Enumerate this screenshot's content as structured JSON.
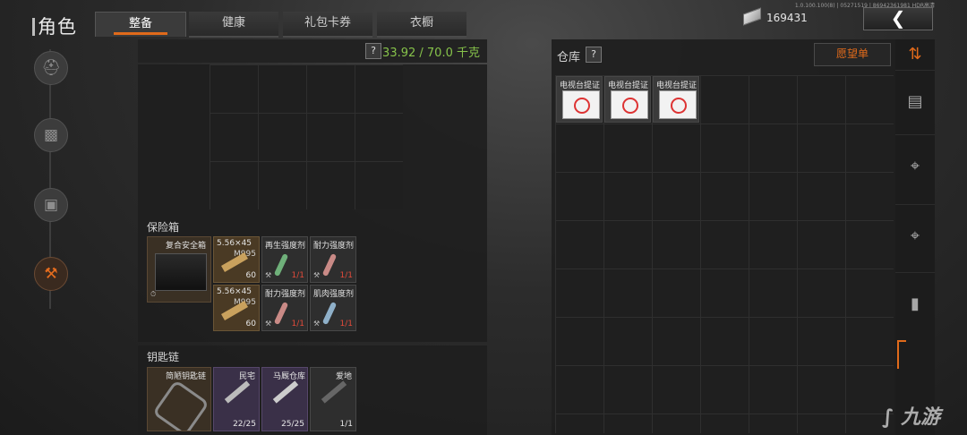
{
  "header": {
    "title": "角色",
    "tabs": [
      {
        "label": "整备",
        "active": true
      },
      {
        "label": "健康",
        "active": false
      },
      {
        "label": "礼包卡券",
        "active": false
      },
      {
        "label": "衣橱",
        "active": false
      }
    ],
    "currency_amount": "169431",
    "version_text": "1.0.100.100(8) | 05271519 | 86942361981 HDR高清",
    "back_icon": "chevron-left-icon"
  },
  "left_rail": {
    "items": [
      {
        "icon": "helmet-icon",
        "active": false
      },
      {
        "icon": "vest-icon",
        "active": false
      },
      {
        "icon": "backpack-icon",
        "active": false
      },
      {
        "icon": "wrench-icon",
        "active": true
      }
    ]
  },
  "inventory": {
    "weight_text": "33.92 / 70.0 千克",
    "help_label": "?"
  },
  "safebox": {
    "label": "保险箱",
    "container_name": "复合安全箱",
    "items": [
      {
        "name": "5.56×45",
        "sub": "M995",
        "count": "60",
        "type": "ammo"
      },
      {
        "name": "再生强度剂",
        "count": "1/1",
        "type": "syringe",
        "color": "#6fb07a"
      },
      {
        "name": "耐力强度剂",
        "count": "1/1",
        "type": "syringe",
        "color": "#c98a86"
      },
      {
        "name": "5.56×45",
        "sub": "M995",
        "count": "60",
        "type": "ammo"
      },
      {
        "name": "耐力强度剂",
        "count": "1/1",
        "type": "syringe",
        "color": "#c98a86"
      },
      {
        "name": "肌肉强度剂",
        "count": "1/1",
        "type": "syringe",
        "color": "#8fb0c9"
      }
    ]
  },
  "keychain": {
    "label": "钥匙链",
    "container_name": "简陋钥匙链",
    "keys": [
      {
        "name": "民宅",
        "count": "22/25"
      },
      {
        "name": "马厩仓库",
        "count": "25/25"
      },
      {
        "name": "爱地",
        "count": "1/1"
      }
    ]
  },
  "warehouse": {
    "label": "仓库",
    "help_label": "?",
    "wishlist_label": "愿望单",
    "items": [
      {
        "name": "电视台提证"
      },
      {
        "name": "电视台提证"
      },
      {
        "name": "电视台提证"
      }
    ],
    "categories": [
      "sort-icon",
      "all-items-icon",
      "rifle-icon",
      "smg-icon",
      "magazine-icon"
    ]
  },
  "watermark": "九游"
}
